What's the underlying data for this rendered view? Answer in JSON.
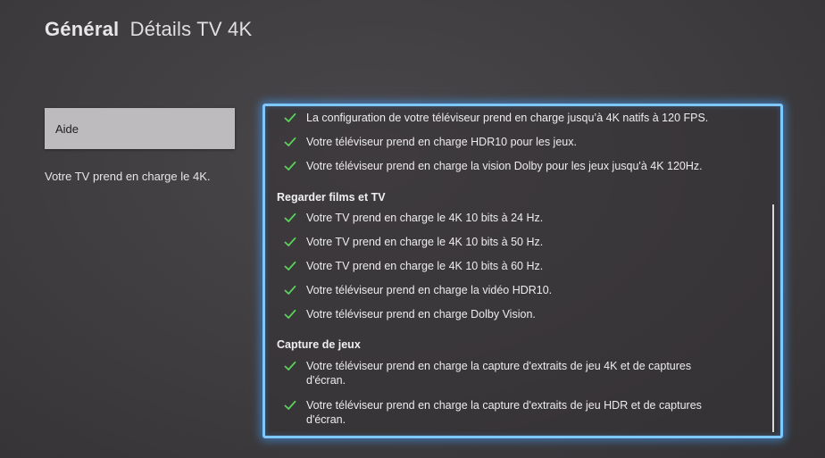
{
  "header": {
    "section": "Général",
    "page": "Détails TV 4K"
  },
  "sidebar": {
    "help_label": "Aide",
    "note": "Votre TV prend en charge le 4K."
  },
  "panel": {
    "check_color": "#5bd35b",
    "accent_color": "#7fc8ff",
    "top_items": [
      "La configuration de votre téléviseur prend en charge jusqu’à 4K natifs à 120 FPS.",
      "Votre téléviseur prend en charge HDR10 pour les jeux.",
      "Votre téléviseur prend en charge la vision Dolby pour les jeux jusqu'à 4K 120Hz."
    ],
    "groups": [
      {
        "title": "Regarder films et TV",
        "items": [
          "Votre TV prend en charge le 4K 10 bits à 24 Hz.",
          "Votre TV prend en charge le 4K 10 bits à 50 Hz.",
          "Votre TV prend en charge le 4K 10 bits à 60 Hz.",
          "Votre téléviseur prend en charge la vidéo HDR10.",
          "Votre téléviseur prend en charge Dolby Vision."
        ]
      },
      {
        "title": "Capture de jeux",
        "items": [
          "Votre téléviseur prend en charge la capture d'extraits de jeu 4K et de captures d'écran.",
          "Votre téléviseur prend en charge la capture d'extraits de jeu HDR et de captures d'écran."
        ]
      }
    ]
  }
}
